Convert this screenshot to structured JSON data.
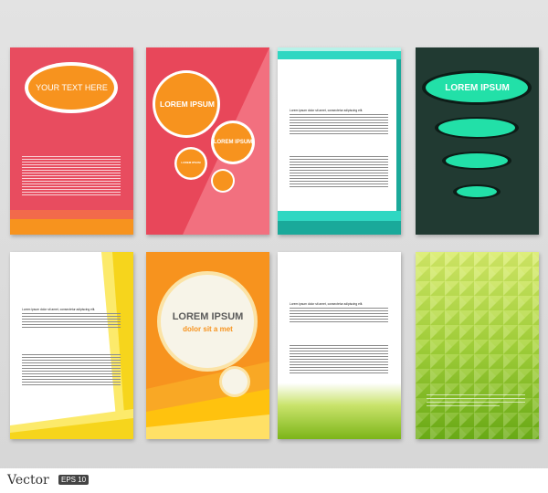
{
  "cards": {
    "c1": {
      "title": "YOUR TEXT HERE",
      "colors": {
        "bg": "#e84c5f",
        "accent": "#f7931e"
      }
    },
    "c2": {
      "title_main": "LOREM IPSUM",
      "title_secondary": "LOREM IPSUM",
      "title_small": "LOREM IPSUM",
      "colors": {
        "bg": "#e8475a",
        "accent": "#f7931e"
      }
    },
    "c3": {
      "lead": "Lorem ipsum dolor sit amet, consectetur adipiscing elit.",
      "colors": {
        "accent": "#2fd7c2"
      }
    },
    "c4": {
      "title": "LOREM IPSUM",
      "colors": {
        "bg": "#213a32",
        "accent": "#22e0a8"
      }
    },
    "c5": {
      "lead": "Lorem ipsum dolor sit amet, consectetur adipiscing elit.",
      "colors": {
        "accent": "#f6d51c"
      }
    },
    "c6": {
      "title": "LOREM IPSUM",
      "subtitle": "dolor sit a met",
      "colors": {
        "bg": "#f7931e",
        "accent": "#ffc20e"
      }
    },
    "c7": {
      "lead": "Lorem ipsum dolor sit amet, consectetur adipiscing elit.",
      "colors": {
        "accent": "#9acd32"
      }
    },
    "c8": {
      "colors": {
        "light": "#d4e85a",
        "dark": "#7cb518"
      }
    }
  },
  "footer": {
    "brand": "Vector",
    "badge": "EPS 10"
  }
}
